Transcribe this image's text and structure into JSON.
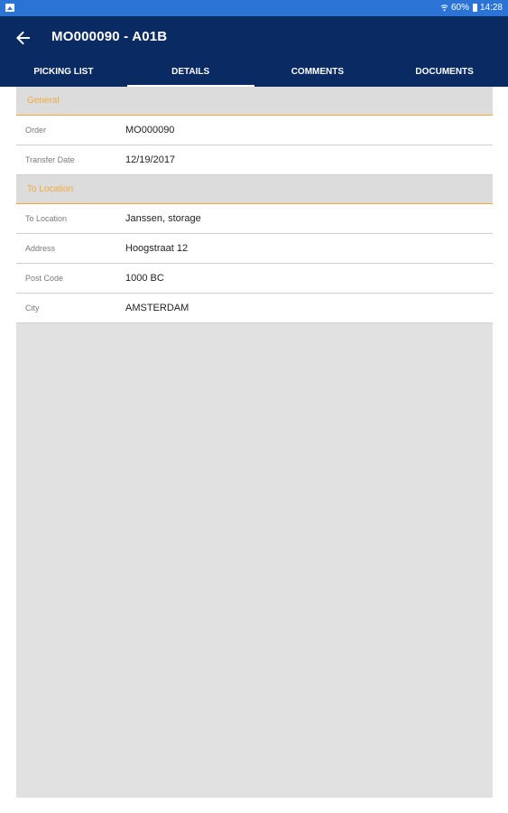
{
  "status_bar": {
    "battery_percent": "60%",
    "time": "14:28"
  },
  "header": {
    "title": "MO000090 - A01B"
  },
  "tabs": [
    {
      "label": "PICKING LIST",
      "active": false
    },
    {
      "label": "DETAILS",
      "active": true
    },
    {
      "label": "COMMENTS",
      "active": false
    },
    {
      "label": "DOCUMENTS",
      "active": false
    }
  ],
  "sections": {
    "general": {
      "title": "General",
      "rows": [
        {
          "label": "Order",
          "value": "MO000090"
        },
        {
          "label": "Transfer Date",
          "value": "12/19/2017"
        }
      ]
    },
    "to_location": {
      "title": "To Location",
      "rows": [
        {
          "label": "To Location",
          "value": "Janssen, storage"
        },
        {
          "label": "Address",
          "value": "Hoogstraat 12"
        },
        {
          "label": "Post Code",
          "value": "1000 BC"
        },
        {
          "label": "City",
          "value": "AMSTERDAM"
        }
      ]
    }
  },
  "colors": {
    "status_bar": "#2b74d6",
    "app_bar": "#0a2a63",
    "section_accent": "#f0a93a",
    "content_background": "#e1e1e1"
  }
}
